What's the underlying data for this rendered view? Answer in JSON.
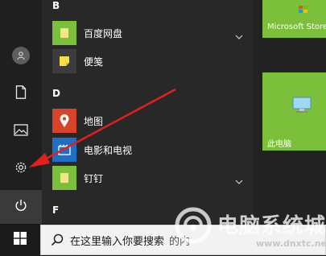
{
  "app_list": {
    "sections": [
      {
        "letter": "B"
      },
      {
        "letter": "D"
      },
      {
        "letter": "F"
      }
    ],
    "items": [
      {
        "label": "百度网盘",
        "icon": "folder-icon",
        "expandable": true
      },
      {
        "label": "便笺",
        "icon": "sticky-note-icon",
        "expandable": false
      },
      {
        "label": "地图",
        "icon": "maps-pin-icon",
        "expandable": false
      },
      {
        "label": "电影和电视",
        "icon": "film-tv-icon",
        "expandable": false
      },
      {
        "label": "钉钉",
        "icon": "folder-icon",
        "expandable": true
      }
    ]
  },
  "tiles": [
    {
      "label": "Microsoft Store",
      "icon": "store-bag-icon"
    },
    {
      "label": "此电脑",
      "icon": "this-pc-icon"
    }
  ],
  "rail": [
    {
      "name": "user-avatar",
      "icon": "user-icon"
    },
    {
      "name": "documents",
      "icon": "document-icon"
    },
    {
      "name": "pictures",
      "icon": "pictures-icon"
    },
    {
      "name": "settings",
      "icon": "gear-icon"
    },
    {
      "name": "power",
      "icon": "power-icon"
    }
  ],
  "taskbar": {
    "search_placeholder": "在这里输入你要搜索",
    "search_text_trail": "的内"
  },
  "watermark": {
    "title": "电脑系统城",
    "url": "www.dnxtc.net"
  },
  "colors": {
    "accent_green": "#7cbf3b",
    "arrow_red": "#e3201b",
    "taskbar": "#1a1a1a",
    "search_bg": "#f2f2f2"
  }
}
